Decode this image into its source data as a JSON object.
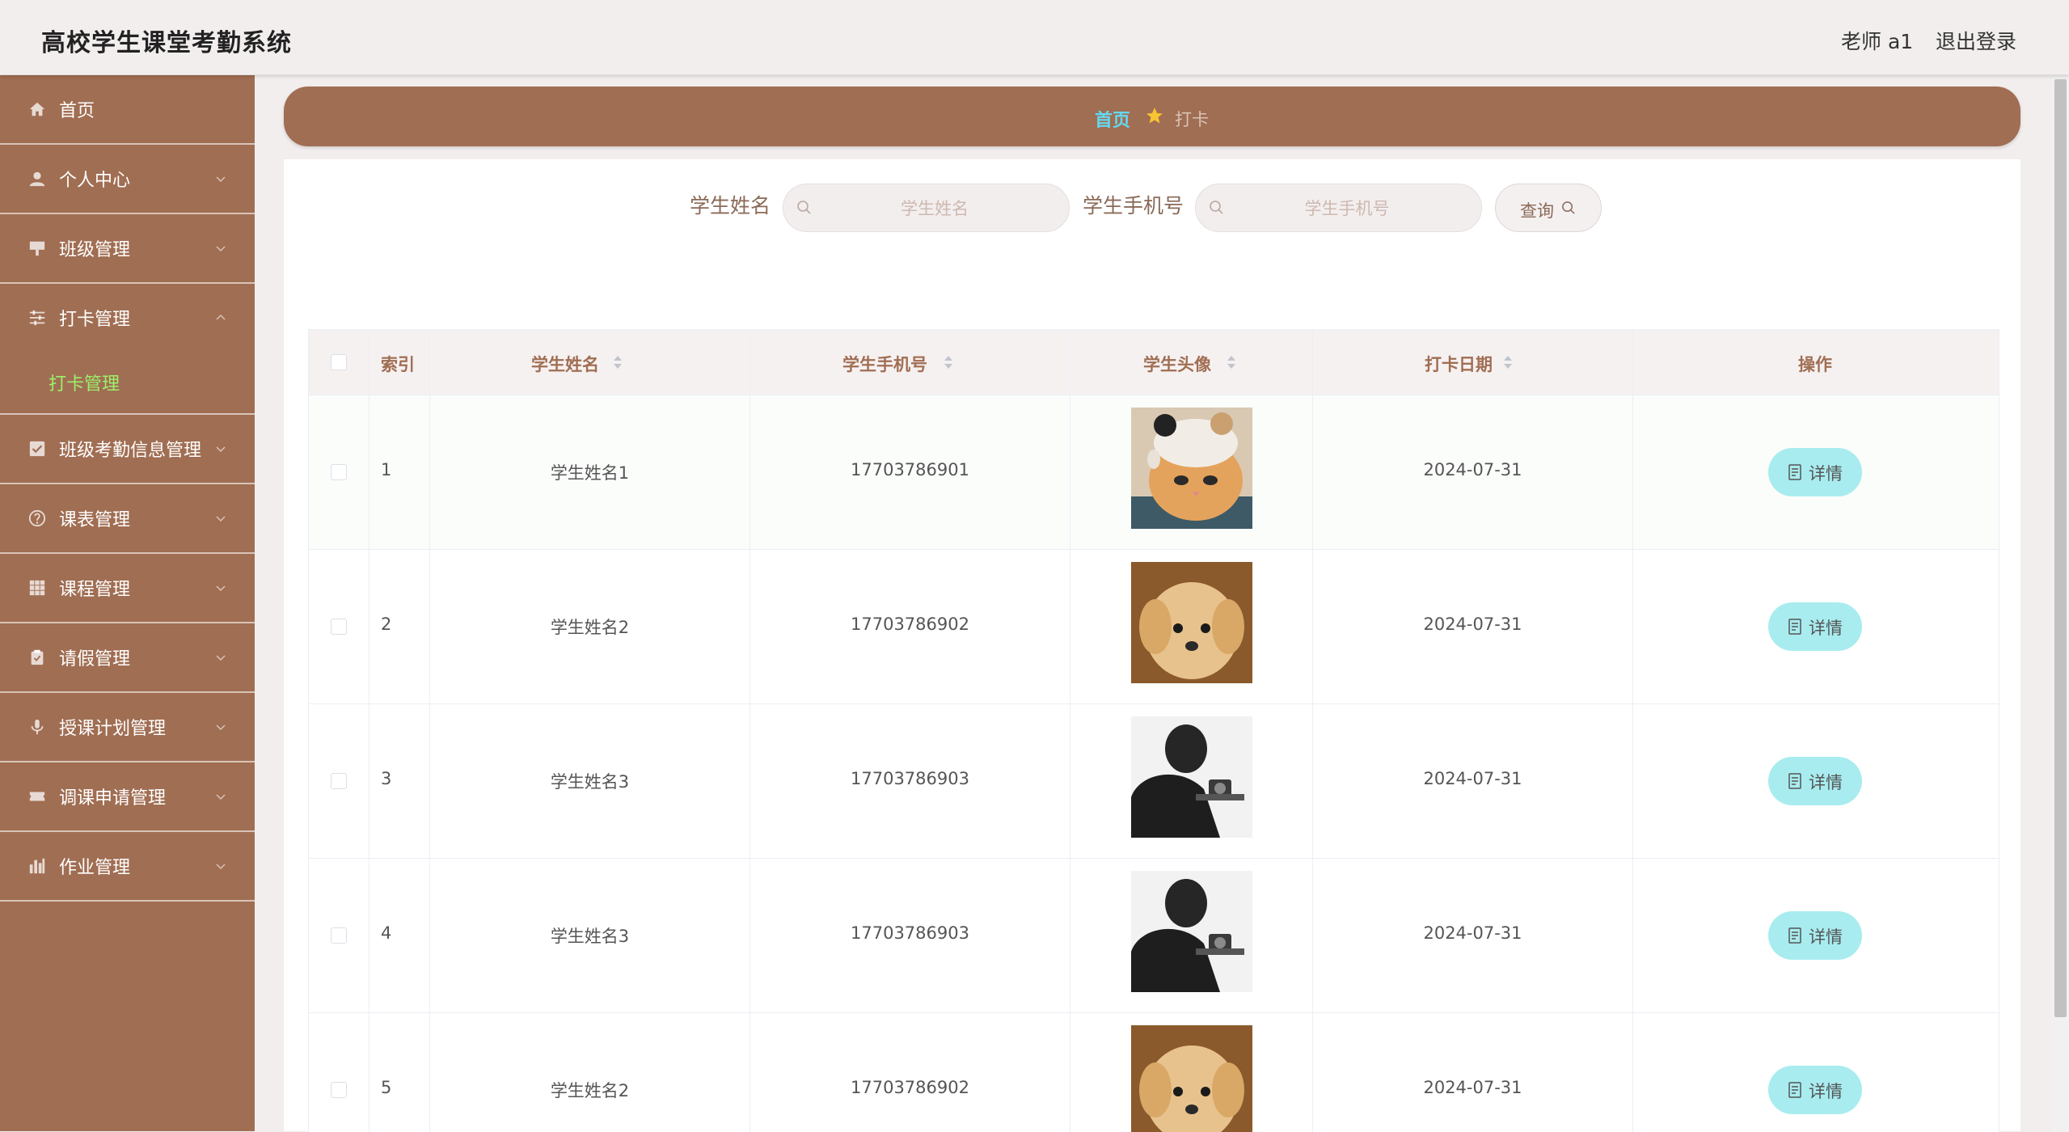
{
  "header": {
    "app_title": "高校学生课堂考勤系统",
    "user_label": "老师 a1",
    "logout_label": "退出登录"
  },
  "sidebar": {
    "items": [
      {
        "label": "首页",
        "icon": "home-icon"
      },
      {
        "label": "个人中心",
        "icon": "user-icon"
      },
      {
        "label": "班级管理",
        "icon": "board-icon"
      },
      {
        "label": "打卡管理",
        "icon": "sliders-icon",
        "expanded": true
      },
      {
        "label": "班级考勤信息管理",
        "icon": "check-square-icon"
      },
      {
        "label": "课表管理",
        "icon": "help-circle-icon"
      },
      {
        "label": "课程管理",
        "icon": "grid-icon"
      },
      {
        "label": "请假管理",
        "icon": "clipboard-icon"
      },
      {
        "label": "授课计划管理",
        "icon": "microphone-icon"
      },
      {
        "label": "调课申请管理",
        "icon": "ticket-icon"
      },
      {
        "label": "作业管理",
        "icon": "bar-chart-icon"
      }
    ],
    "submenu": {
      "label": "打卡管理"
    }
  },
  "breadcrumb": {
    "home": "首页",
    "current": "打卡"
  },
  "search": {
    "name_label": "学生姓名",
    "name_placeholder": "学生姓名",
    "phone_label": "学生手机号",
    "phone_placeholder": "学生手机号",
    "query_label": "查询"
  },
  "table": {
    "columns": {
      "index": "索引",
      "name": "学生姓名",
      "phone": "学生手机号",
      "avatar": "学生头像",
      "date": "打卡日期",
      "action": "操作"
    },
    "rows": [
      {
        "index": "1",
        "name": "学生姓名1",
        "phone": "17703786901",
        "avatar": "cat-photo",
        "date": "2024-07-31",
        "action": "详情"
      },
      {
        "index": "2",
        "name": "学生姓名2",
        "phone": "17703786902",
        "avatar": "puppy-photo",
        "date": "2024-07-31",
        "action": "详情"
      },
      {
        "index": "3",
        "name": "学生姓名3",
        "phone": "17703786903",
        "avatar": "man-camera-photo",
        "date": "2024-07-31",
        "action": "详情"
      },
      {
        "index": "4",
        "name": "学生姓名3",
        "phone": "17703786903",
        "avatar": "man-camera-photo",
        "date": "2024-07-31",
        "action": "详情"
      },
      {
        "index": "5",
        "name": "学生姓名2",
        "phone": "17703786902",
        "avatar": "puppy-photo",
        "date": "2024-07-31",
        "action": "详情"
      }
    ]
  },
  "colors": {
    "brand": "#a06e53",
    "background": "#f3eeee",
    "submenu_active": "#9cf06a",
    "breadcrumb_home": "#64d8f0",
    "detail_button": "#a8ecef"
  }
}
